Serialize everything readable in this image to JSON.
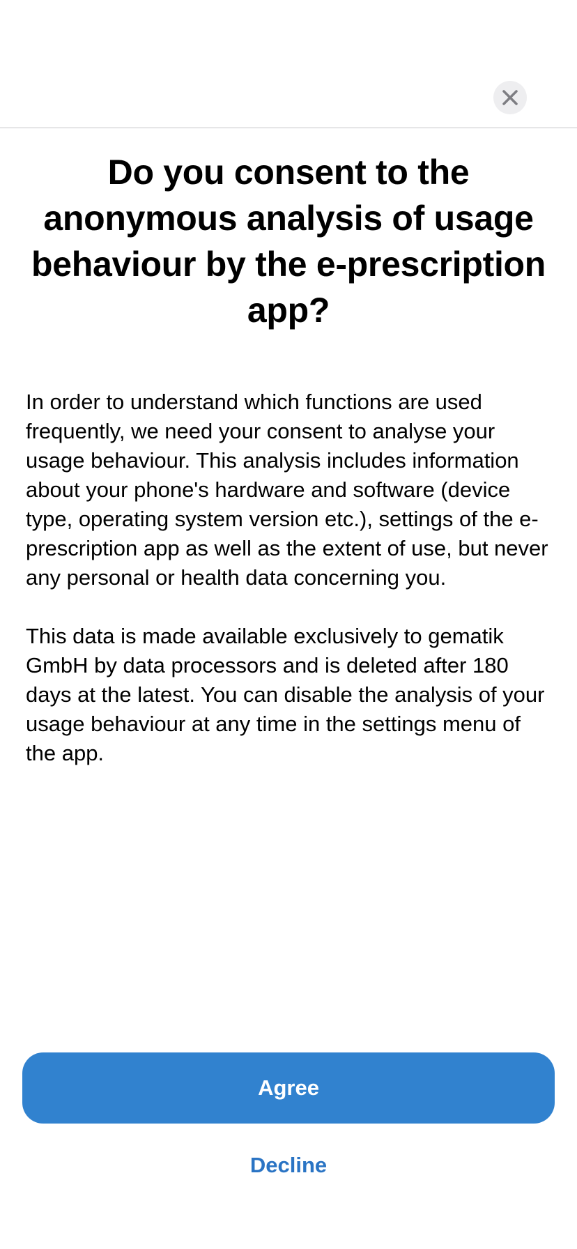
{
  "header": {
    "close_icon": "close-icon"
  },
  "consent": {
    "title": "Do you consent to the anonymous analysis of usage behaviour by the e-prescription app?",
    "paragraph_1": "In order to understand which functions are used frequently, we need your consent to analyse your usage behaviour. This analysis includes information about your phone's hardware and software (device type, operating system version etc.), settings of the e-prescription app as well as the extent of use, but never any personal or health data concerning you.",
    "paragraph_2": "This data is made available exclusively to gematik GmbH by data processors and is deleted after 180 days at the latest. You can disable the analysis of your usage behaviour at any time in the settings menu of the app."
  },
  "actions": {
    "agree_label": "Agree",
    "decline_label": "Decline"
  },
  "colors": {
    "accent": "#3182cf",
    "link": "#2a74c4",
    "close_background": "#eeeef0",
    "close_icon": "#7d7d82"
  }
}
